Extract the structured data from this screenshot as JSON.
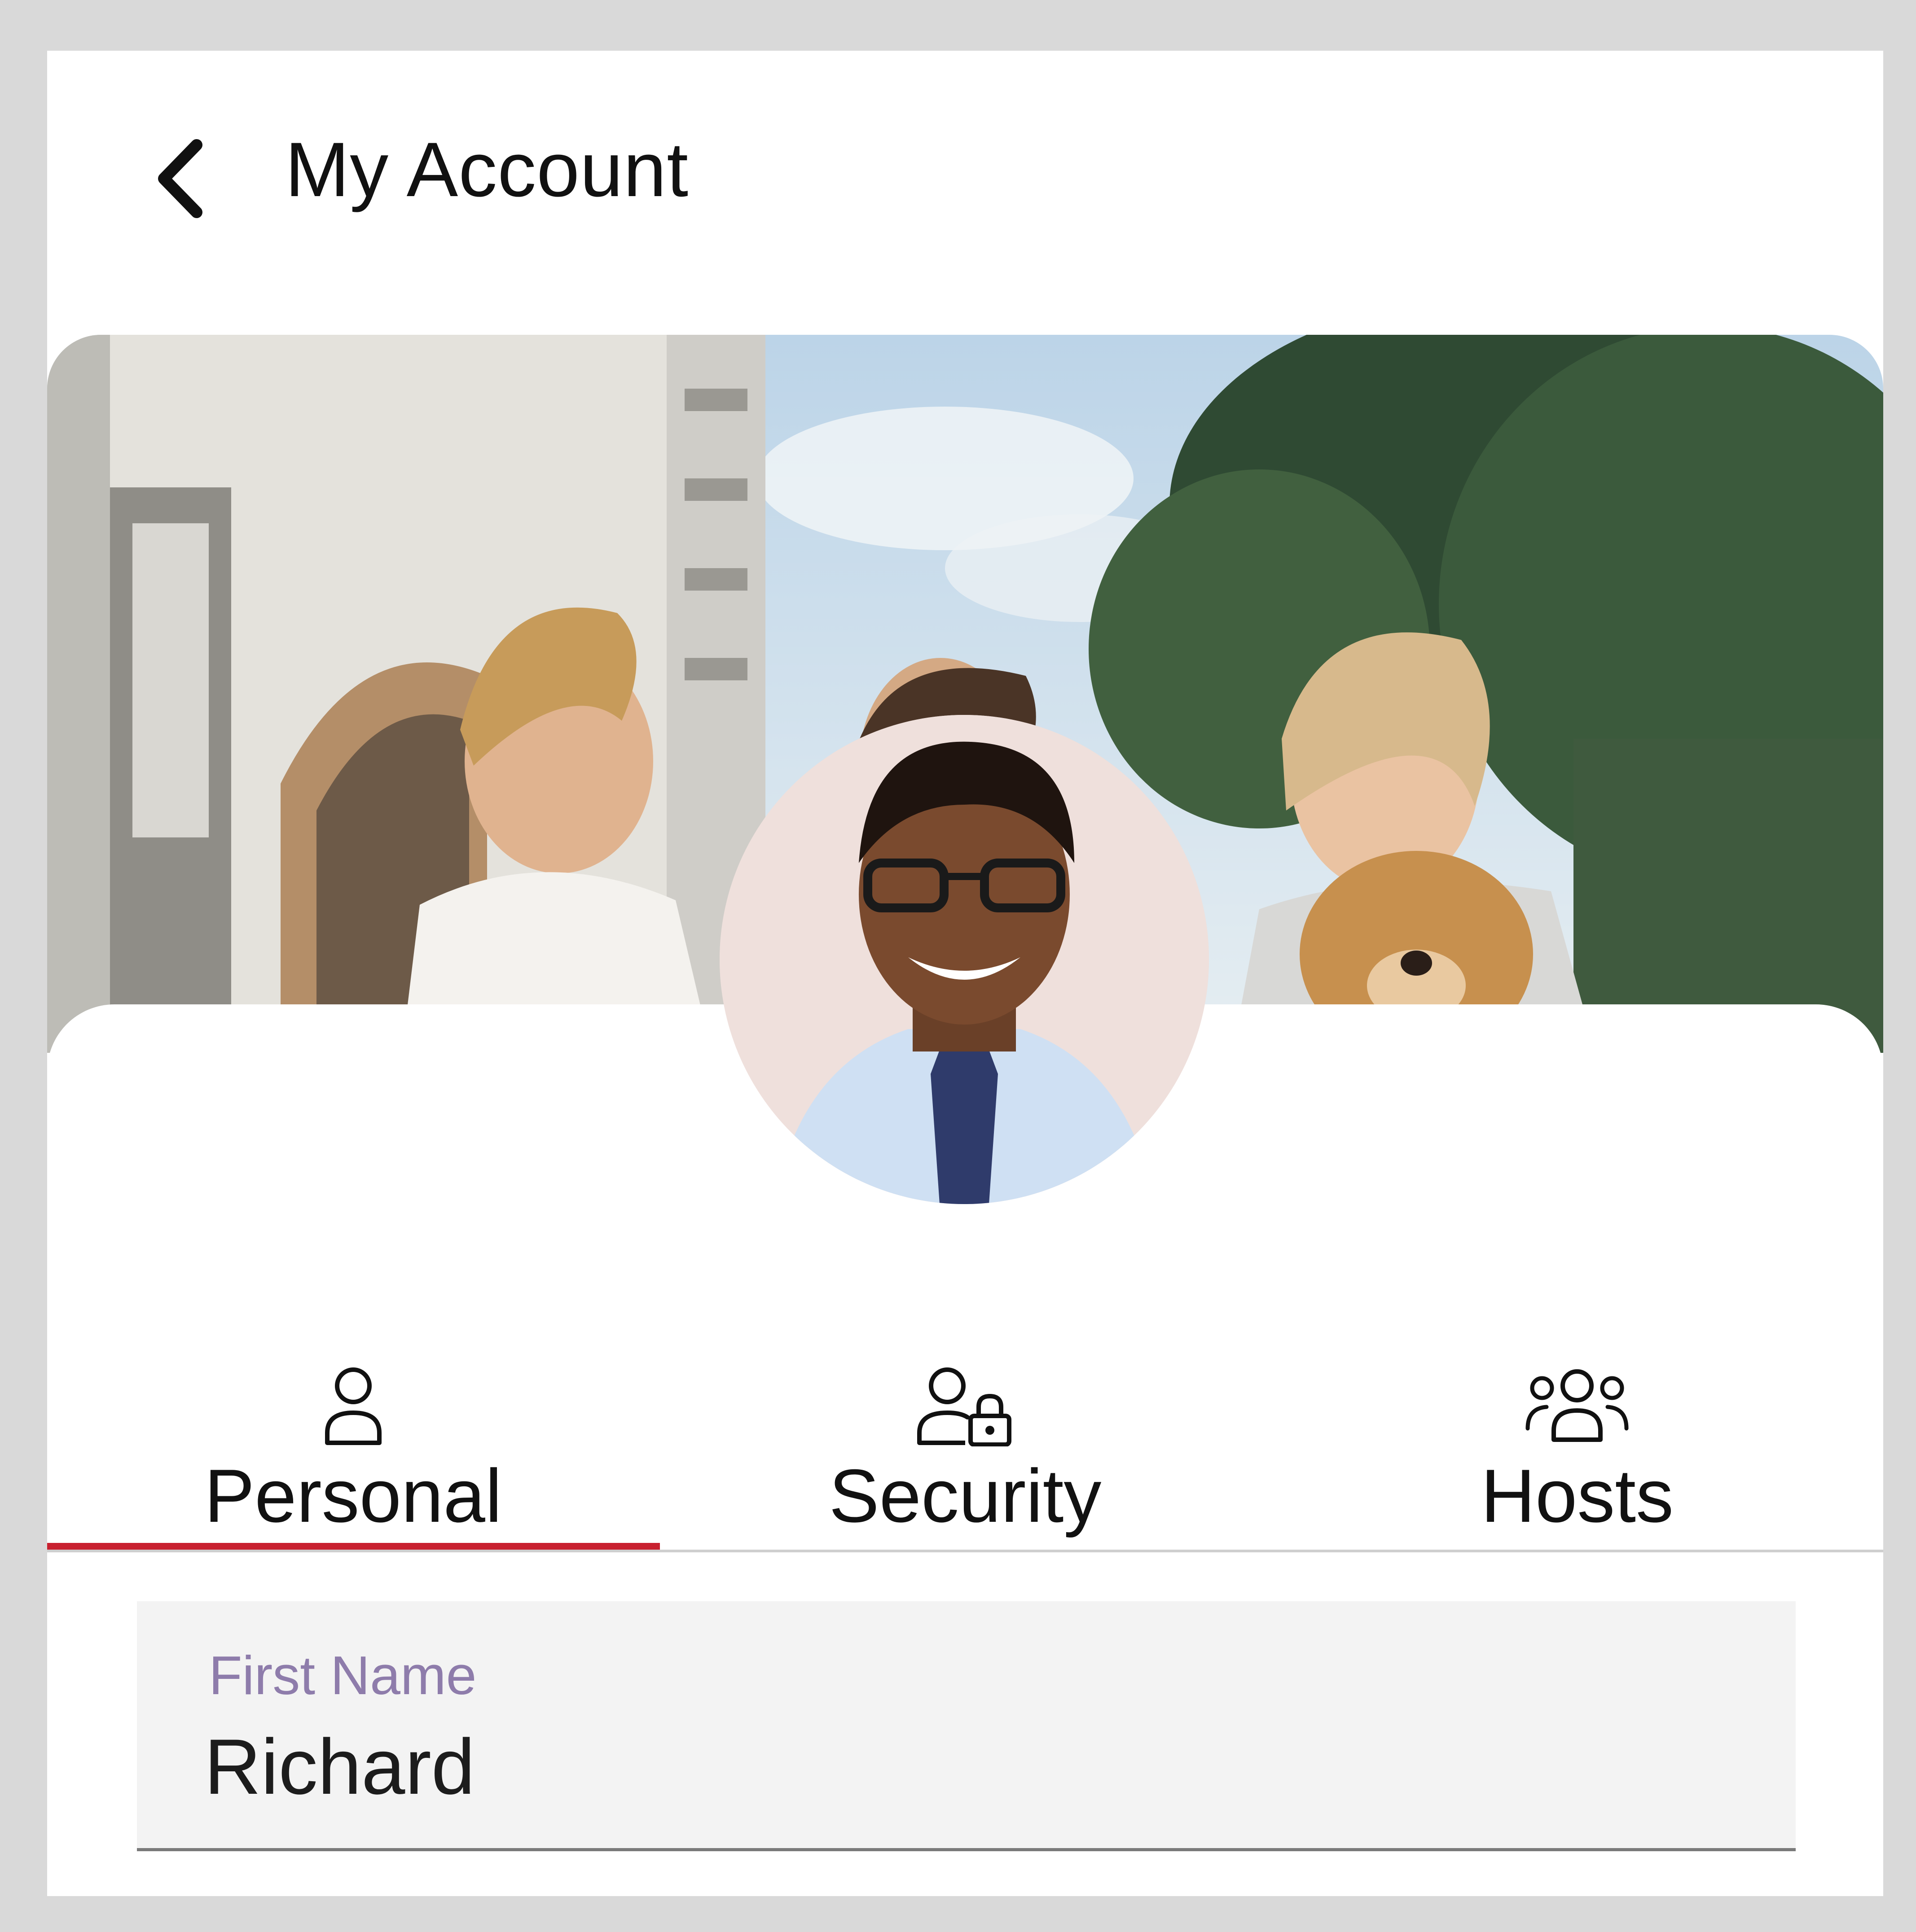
{
  "header": {
    "title": "My Account",
    "back_icon": "chevron-left-icon"
  },
  "banner": {
    "image": "family-with-dog-outdoors-photo"
  },
  "profile": {
    "avatar": "profile-photo"
  },
  "tabs": [
    {
      "label": "Personal",
      "icon": "person-icon",
      "selected": true
    },
    {
      "label": "Security",
      "icon": "person-lock-icon",
      "selected": false
    },
    {
      "label": "Hosts",
      "icon": "group-icon",
      "selected": false
    }
  ],
  "form": {
    "first_name": {
      "label": "First Name",
      "value": "Richard"
    }
  },
  "colors": {
    "accent": "#c8202f",
    "field_label": "#8e7cab",
    "field_bg": "#f3f3f3",
    "page_border": "#d9d9d9"
  }
}
